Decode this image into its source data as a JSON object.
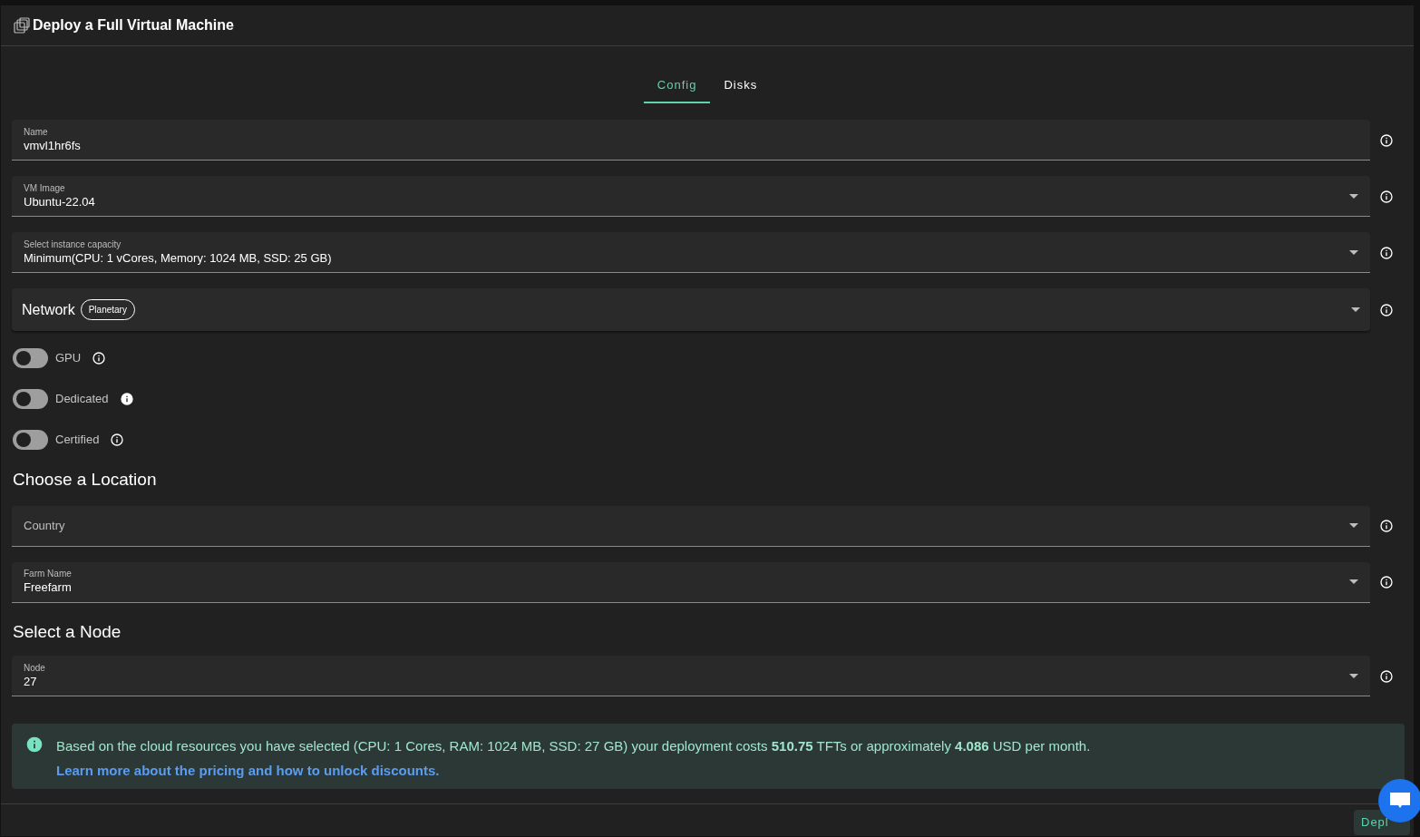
{
  "window": {
    "title": "Deploy a Full Virtual Machine"
  },
  "tabs": [
    {
      "label": "Config",
      "selected": true
    },
    {
      "label": "Disks",
      "selected": false
    }
  ],
  "fields": [
    {
      "kind": "text",
      "label": "Name",
      "value": "vmvl1hr6fs"
    },
    {
      "kind": "select",
      "label": "VM Image",
      "value": "Ubuntu-22.04"
    },
    {
      "kind": "select",
      "label": "Select instance capacity",
      "value": "Minimum(CPU: 1 vCores, Memory: 1024 MB, SSD: 25 GB)"
    }
  ],
  "network": {
    "label": "Network",
    "badge": "Planetary",
    "expanded": false
  },
  "toggles": [
    {
      "label": "GPU",
      "on": false,
      "info_filled": false
    },
    {
      "label": "Dedicated",
      "on": false,
      "info_filled": true
    },
    {
      "label": "Certified",
      "on": false,
      "info_filled": false
    }
  ],
  "location": {
    "heading": "Choose a Location",
    "fields": [
      {
        "kind": "select",
        "placeholder": "Country"
      },
      {
        "kind": "select",
        "label": "Farm Name",
        "value": "Freefarm"
      }
    ]
  },
  "node": {
    "heading": "Select a Node",
    "fields": [
      {
        "kind": "select",
        "label": "Node",
        "value": "27"
      }
    ]
  },
  "alert": {
    "message": "Based on the cloud resources you have selected (CPU: 1 Cores, RAM: 1024 MB, SSD: 27 GB) your deployment costs **510.75** TFTs or approximately **4.086** USD per month.",
    "link": "Learn more about the pricing and how to unlock discounts."
  },
  "footer": {
    "deploy_button": "Depl"
  }
}
